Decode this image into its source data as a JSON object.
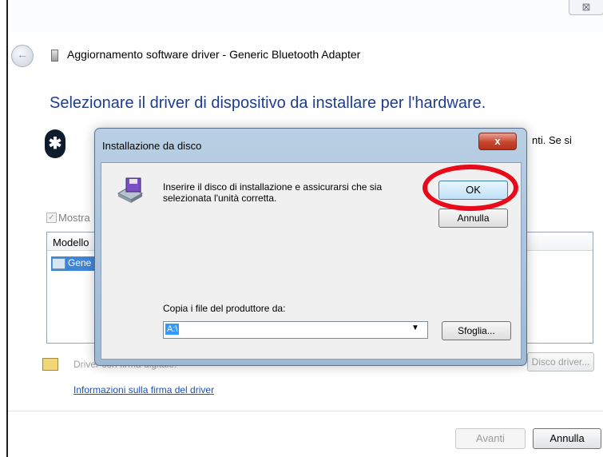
{
  "wizard": {
    "close_glyph": "⊠",
    "title": "Aggiornamento software driver - Generic Bluetooth Adapter",
    "heading": "Selezionare il driver di dispositivo da installare per l'hardware.",
    "right_text": "nti. Se si",
    "show_compatible_label": "Mostra",
    "model_column_header": "Modello",
    "model_row": "Gene",
    "driver_status": "Driver con firma digitale.",
    "disk_button": "Disco driver...",
    "signature_link": "Informazioni sulla firma del driver",
    "next_button": "Avanti",
    "cancel_button": "Annulla",
    "icons": {
      "back": "back-arrow-icon",
      "device": "device-icon",
      "bluetooth": "bluetooth-icon",
      "driver": "certificate-icon"
    }
  },
  "dialog": {
    "title": "Installazione da disco",
    "close_glyph": "x",
    "message": "Inserire il disco di installazione e assicurarsi che sia selezionata l'unità corretta.",
    "ok_button": "OK",
    "cancel_button": "Annulla",
    "copy_label": "Copia i file del produttore da:",
    "path_value": "A:\\",
    "browse_button": "Sfoglia...",
    "highlight_color": "#e8091a",
    "icons": {
      "disk": "floppy-disk-icon"
    }
  }
}
